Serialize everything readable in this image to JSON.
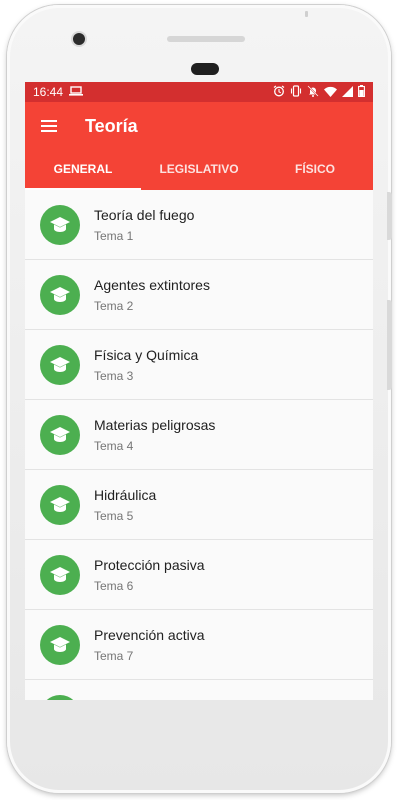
{
  "status": {
    "time": "16:44"
  },
  "appbar": {
    "title": "Teoría"
  },
  "tabs": [
    {
      "label": "GENERAL"
    },
    {
      "label": "LEGISLATIVO"
    },
    {
      "label": "FÍSICO"
    }
  ],
  "items": [
    {
      "title": "Teoría del fuego",
      "subtitle": "Tema 1"
    },
    {
      "title": "Agentes extintores",
      "subtitle": "Tema 2"
    },
    {
      "title": "Física y Química",
      "subtitle": "Tema 3"
    },
    {
      "title": "Materias peligrosas",
      "subtitle": "Tema 4"
    },
    {
      "title": "Hidráulica",
      "subtitle": "Tema 5"
    },
    {
      "title": "Protección pasiva",
      "subtitle": "Tema 6"
    },
    {
      "title": "Prevención activa",
      "subtitle": "Tema 7"
    }
  ],
  "colors": {
    "primary": "#f44336",
    "statusbar": "#d32f2f",
    "avatar": "#4caf50"
  },
  "icons": {
    "item": "graduation-cap-icon",
    "menu": "menu-icon"
  }
}
